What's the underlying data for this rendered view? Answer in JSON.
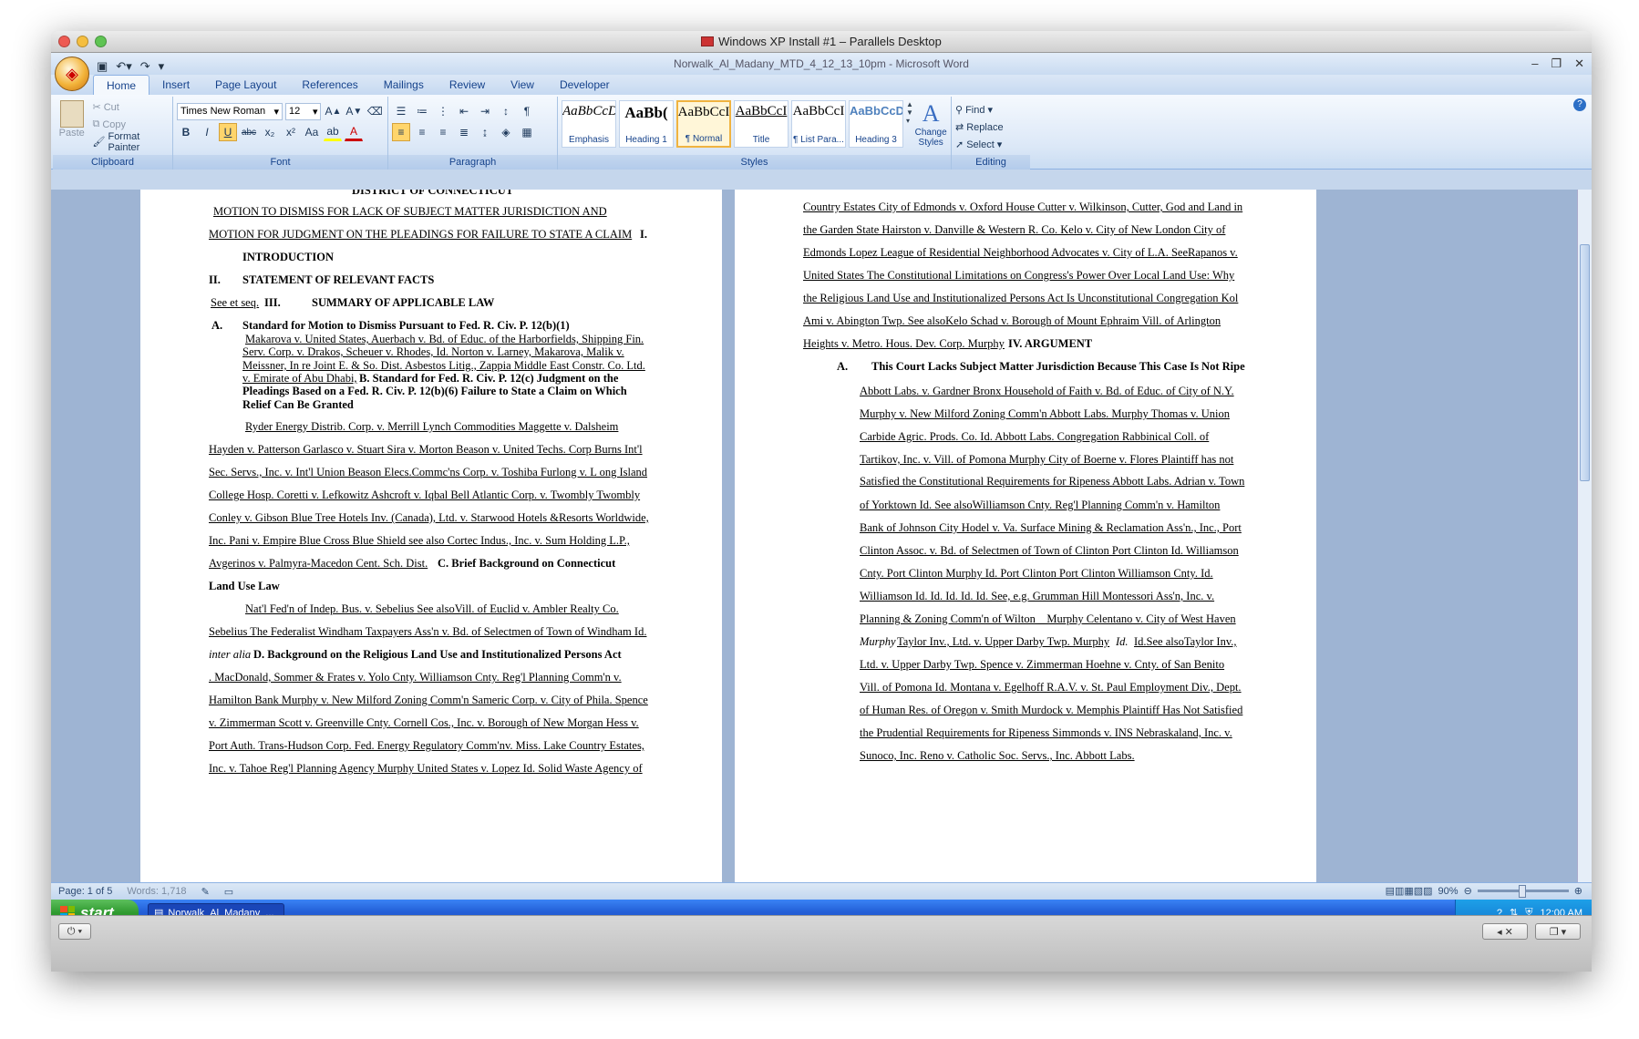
{
  "mac_window": {
    "title": "Windows XP Install #1 – Parallels Desktop"
  },
  "word": {
    "title": "Norwalk_Al_Madany_MTD_4_12_13_10pm - Microsoft Word",
    "tabs": [
      "Home",
      "Insert",
      "Page Layout",
      "References",
      "Mailings",
      "Review",
      "View",
      "Developer"
    ],
    "clipboard": {
      "paste": "Paste",
      "cut": "Cut",
      "copy": "Copy",
      "format_painter": "Format Painter",
      "label": "Clipboard"
    },
    "font": {
      "name": "Times New Roman",
      "size": "12",
      "label": "Font"
    },
    "paragraph": {
      "label": "Paragraph"
    },
    "styles": {
      "items": [
        {
          "preview": "AaBbCcD",
          "name": "Emphasis"
        },
        {
          "preview": "AaBb(",
          "name": "Heading 1"
        },
        {
          "preview": "AaBbCcI",
          "name": "¶ Normal"
        },
        {
          "preview": "AaBbCcI",
          "name": "Title"
        },
        {
          "preview": "AaBbCcI",
          "name": "¶ List Para..."
        },
        {
          "preview": "AaBbCcD",
          "name": "Heading 3"
        }
      ],
      "change_styles": "Change Styles",
      "label": "Styles"
    },
    "editing": {
      "find": "Find",
      "replace": "Replace",
      "select": "Select",
      "label": "Editing"
    },
    "status": {
      "page": "Page: 1 of 5",
      "words": "Words: 1,718",
      "zoom": "90%"
    }
  },
  "doc_left": [
    "DISTRICT OF CONNECTICUT",
    "MOTION TO DISMISS FOR LACK OF SUBJECT MATTER JURISDICTION AND",
    "MOTION FOR JUDGMENT ON THE PLEADINGS FOR FAILURE TO STATE A CLAIM",
    "I.",
    "INTRODUCTION",
    "II.",
    "STATEMENT OF RELEVANT FACTS",
    "See et seq.",
    "III.",
    "SUMMARY OF APPLICABLE LAW",
    "A.",
    "Standard for Motion to Dismiss Pursuant to Fed. R. Civ. P. 12(b)(1)",
    "Makarova v. United States, Auerbach v. Bd. of Educ. of the Harborfields, Shipping Fin.",
    "Serv. Corp. v. Drakos, Scheuer v. Rhodes, Id. Norton v. Larney, Makarova, Malik v.",
    "Meissner, In re Joint E. & So. Dist. Asbestos Litig., Zappia Middle East Constr. Co. Ltd.",
    "v. Emirate of Abu Dhabi,",
    "B.   Standard for Fed. R. Civ. P. 12(c) Judgment on the",
    "Pleadings Based on a Fed. R. Civ. P. 12(b)(6) Failure to State a Claim on Which",
    "Relief Can Be Granted",
    "Ryder Energy Distrib. Corp. v. Merrill Lynch Commodities  Maggette v. Dalsheim",
    "Hayden v. Patterson  Garlasco v. Stuart  Sira v. Morton  Beason v. United Techs. Corp  Burns Int'l",
    "Sec. Servs., Inc. v. Int'l Union  Beason  Elecs.Commc'ns Corp. v. Toshiba  Furlong v. L ong Island",
    "College Hosp.  Coretti v. Lefkowitz  Ashcroft v. Iqbal  Bell Atlantic Corp. v. Twombly  Twombly",
    "Conley v. Gibson  Blue Tree Hotels Inv. (Canada), Ltd. v. Starwood Hotels &Resorts Worldwide,",
    "Inc.  Pani v. Empire Blue Cross Blue Shield  see also  Cortec Indus., Inc. v. Sum Holding L.P.,",
    "Avgerinos v. Palmyra-Macedon Cent. Sch. Dist.",
    "C.          Brief Background on Connecticut",
    "Land Use Law",
    "Nat'l Fed'n of Indep. Bus. v. Sebelius  See alsoVill. of Euclid v. Ambler Realty Co.",
    "Sebelius  The Federalist  Windham Taxpayers  Ass'n v. Bd. of Selectmen of Town of Windham  Id.",
    "inter alia",
    "D. Background on the Religious Land Use and Institutionalized Persons Act",
    ". MacDonald, Sommer & Frates v. Yolo Cnty.  Williamson Cnty. Reg'l Planning Comm'n v.",
    "Hamilton Bank  Murphy v. New Milford Zoning Comm'n  Sameric Corp. v. City of Phila.  Spence",
    "v. Zimmerman  Scott v. Greenville Cnty.  Cornell Cos., Inc. v. Borough of New Morgan  Hess v.",
    "Port Auth. Trans-Hudson Corp.  Fed. Energy Regulatory Comm'nv. Miss.  Lake Country Estates,",
    "Inc. v. Tahoe Reg'l Planning Agency  Murphy  United States v. Lopez  Id.  Solid Waste Agency of"
  ],
  "doc_right": [
    "Country Estates  City of Edmonds v. Oxford House  Cutter v. Wilkinson,  Cutter,  God and Land in",
    "the Garden State  Hairston v. Danville & Western R. Co.  Kelo v. City of New London  City of",
    "Edmonds  Lopez  League of Residential Neighborhood Advocates v. City of L.A.  SeeRapanos v.",
    "United States  The Constitutional Limitations on Congress's Power Over Local Land Use: Why",
    "the Religious Land Use and Institutionalized Persons Act Is Unconstitutional  Congregation Kol",
    "Ami v. Abington Twp.  See alsoKelo  Schad v. Borough of Mount Ephraim  Vill. of Arlington",
    "Heights v. Metro. Hous. Dev. Corp.  Murphy",
    "IV.        ARGUMENT",
    "A.",
    "This Court Lacks Subject Matter Jurisdiction Because This Case Is Not Ripe",
    "Abbott Labs. v. Gardner  Bronx Household of Faith v. Bd. of Educ. of City of N.Y.",
    "Murphy v. New Milford Zoning Comm'n  Abbott Labs.  Murphy  Thomas v. Union",
    "Carbide Agric. Prods. Co.  Id. Abbott Labs.  Congregation Rabbinical Coll. of",
    "Tartikov, Inc. v. Vill. of Pomona  Murphy  City of Boerne v. Flores  Plaintiff has not",
    "Satisfied the Constitutional Requirements for Ripeness  Abbott Labs.  Adrian v. Town",
    "of Yorktown  Id.  See alsoWilliamson Cnty. Reg'l Planning Comm'n v. Hamilton",
    "Bank of Johnson City  Hodel v. Va. Surface Mining & Reclamation Ass'n., Inc.,  Port",
    "Clinton Assoc. v. Bd. of Selectmen of Town of Clinton  Port Clinton  Id.  Williamson",
    "Cnty.  Port Clinton  Murphy  Id.  Port Clinton  Port Clinton  Williamson Cnty.  Id.",
    "Williamson  Id.  Id.  Id.  Id.  Id.  See, e.g.  Grumman Hill Montessori Ass'n, Inc. v.",
    "Planning & Zoning Comm'n of Wilton  _ Murphy  Celentano v. City of West Haven",
    "Murphy",
    "Taylor Inv., Ltd. v. Upper Darby Twp.  Murphy",
    "Id.",
    "Id.See alsoTaylor Inv.,",
    "Ltd. v. Upper Darby Twp.  Spence v. Zimmerman  Hoehne v. Cnty. of San Benito",
    "Vill. of Pomona  Id.  Montana v. Egelhoff  R.A.V. v. St. Paul  Employment Div., Dept.",
    "of Human Res. of Oregon v. Smith  Murdock v. Memphis  Plaintiff Has Not Satisfied",
    "the Prudential Requirements for Ripeness  Simmonds v. INS  Nebraskaland, Inc. v.",
    "Sunoco, Inc.  Reno v. Catholic Soc. Servs., Inc.  Abbott Labs."
  ],
  "taskbar": {
    "start": "start",
    "task_item": "Norwalk_Al_Madany_...",
    "clock": "12:00 AM"
  }
}
